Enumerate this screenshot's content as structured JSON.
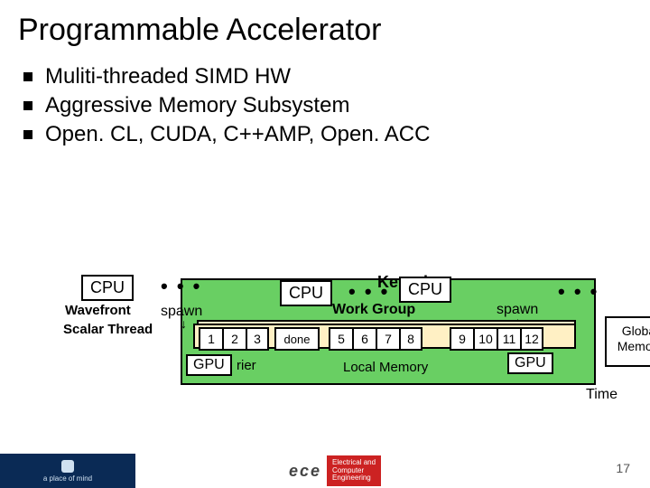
{
  "title": "Programmable Accelerator",
  "bullets": [
    "Muliti-threaded SIMD HW",
    "Aggressive Memory Subsystem",
    "Open. CL, CUDA, C++AMP, Open. ACC"
  ],
  "diagram": {
    "cpu": "CPU",
    "dots": "• • •",
    "kernel": "Kernel",
    "work_group": "Work Group",
    "wavefront": "Wavefront",
    "spawn": "spawn",
    "scalar_thread": "Scalar Thread",
    "cells_a": [
      "1",
      "2",
      "3"
    ],
    "done": "done",
    "cells_b": [
      "5",
      "6",
      "7",
      "8"
    ],
    "cells_c": [
      "9",
      "10",
      "11",
      "12"
    ],
    "gpu": "GPU",
    "barrier_frag": "rier",
    "local_memory": "Local Memory",
    "global_memory_l1": "Global",
    "global_memory_l2": "Memory",
    "time": "Time"
  },
  "slide_number": "17",
  "footer": {
    "ubc": "a place of mind",
    "ece": "ece",
    "ece_tag_l1": "Electrical and",
    "ece_tag_l2": "Computer",
    "ece_tag_l3": "Engineering"
  }
}
